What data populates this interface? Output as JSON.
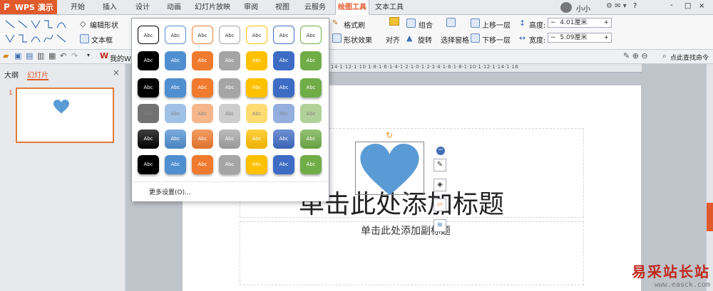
{
  "app": {
    "title": "WPS 演示"
  },
  "tabs": [
    "开始",
    "插入",
    "设计",
    "动画",
    "幻灯片放映",
    "审阅",
    "视图",
    "云服务",
    "绘图工具",
    "文本工具"
  ],
  "active_tab": "绘图工具",
  "window": {
    "user_name": "小小",
    "controls": [
      "?",
      "-",
      "□",
      "×"
    ]
  },
  "ribbon": {
    "edit_shape": "编辑形状",
    "text_box": "文本框",
    "format_brush": "格式刷",
    "shape_effect": "形状效果",
    "group": "组合",
    "align": "对齐",
    "rotate": "旋转",
    "selection_pane": "选择窗格",
    "bring_forward": "上移一层",
    "send_backward": "下移一层",
    "height_label": "高度:",
    "height_value": "4.01厘米",
    "width_label": "宽度:",
    "width_value": "5.09厘米",
    "find_command": "点此查找命令"
  },
  "quick_access": {
    "mywps": "我的WPS"
  },
  "left_panel": {
    "tab_outline": "大纲",
    "tab_slides": "幻灯片",
    "close": "×",
    "slide_number": "1"
  },
  "style_popup": {
    "swatch_label": "Abc",
    "colors": [
      "#000000",
      "#4f8fd0",
      "#f07b2e",
      "#a5a5a5",
      "#ffc000",
      "#3e6cc4",
      "#70ad47"
    ],
    "more_settings": "更多设置(O)..."
  },
  "ruler": {
    "marks": "14·1·12·1·10·1·8·1·6·1·4·1·2·1·0·1·2·1·4·1·6·1·8·1·10·1·12·1·14·1·16"
  },
  "slide": {
    "title_placeholder": "单击此处添加标题",
    "subtitle_placeholder": "单击此处添加副标题",
    "shape_color": "#5b9bd5"
  },
  "watermark": {
    "line1": "易采站长站",
    "line2": "www.easck.com"
  }
}
